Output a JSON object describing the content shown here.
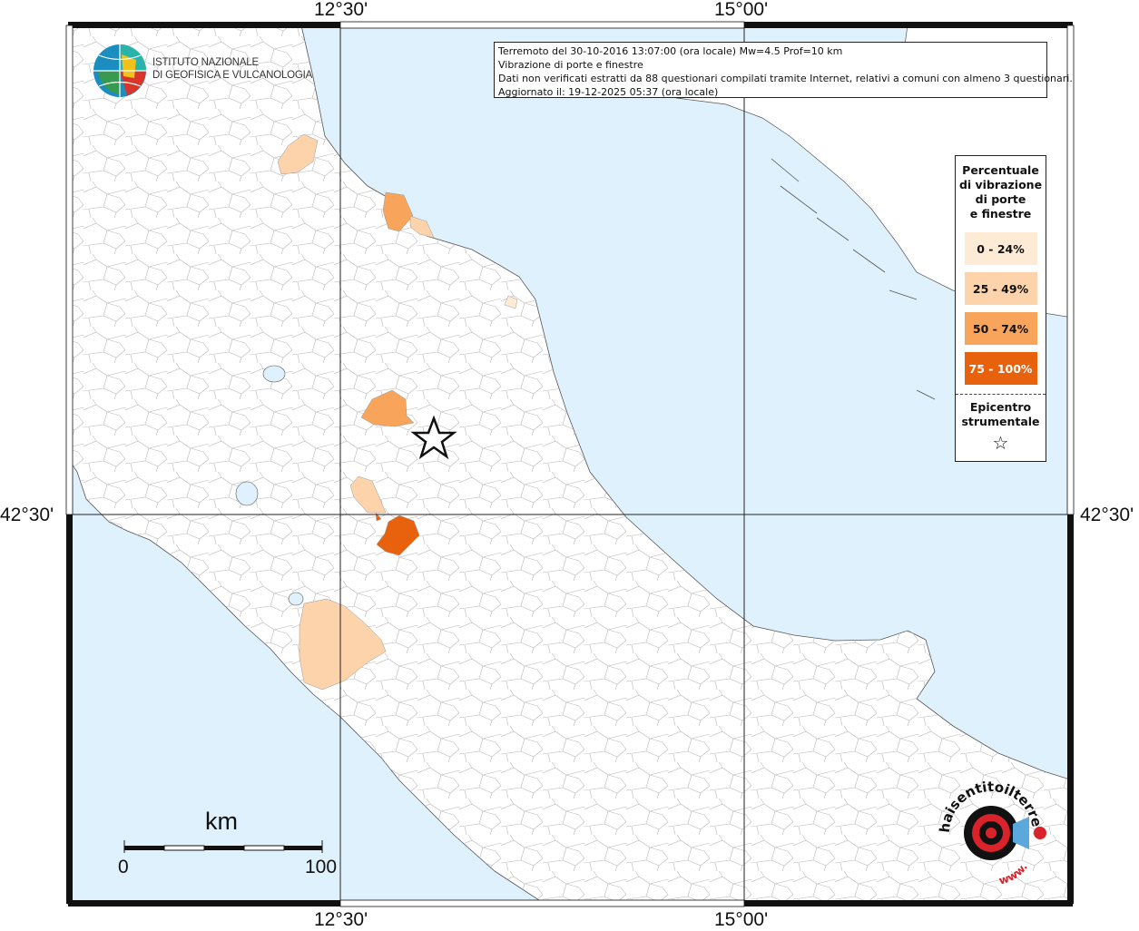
{
  "info": {
    "line1": "Terremoto del 30-10-2016 13:07:00 (ora locale) Mw=4.5 Prof=10 km",
    "line2": "Vibrazione di porte e finestre",
    "line3": "Dati non verificati estratti da 88 questionari compilati tramite Internet, relativi a comuni con almeno 3 questionari.",
    "line4": "Aggiornato il: 19-12-2025 05:37 (ora locale)"
  },
  "axes": {
    "top_left": "12°30'",
    "top_right": "15°00'",
    "bottom_left": "12°30'",
    "bottom_right": "15°00'",
    "left_lat": "42°30'",
    "right_lat": "42°30'"
  },
  "legend": {
    "title": "Percentuale\ndi vibrazione\ndi porte\ne finestre",
    "items": [
      {
        "label": "0 - 24%",
        "color": "#fdebd6",
        "text_color": "#111111"
      },
      {
        "label": "25 - 49%",
        "color": "#fdd3ac",
        "text_color": "#111111"
      },
      {
        "label": "50 - 74%",
        "color": "#f9a45b",
        "text_color": "#111111"
      },
      {
        "label": "75 - 100%",
        "color": "#e8620e",
        "text_color": "#ffffff"
      }
    ],
    "epicenter_title": "Epicentro\nstrumentale",
    "epicenter_symbol": "☆"
  },
  "ingv": {
    "line1": "ISTITUTO NAZIONALE",
    "line2": "DI GEOFISICA E VULCANOLOGIA"
  },
  "scale": {
    "title": "km",
    "min": "0",
    "max": "100"
  },
  "hsit_logo": {
    "text": "haisentitoilterremoto.it",
    "www": "www."
  },
  "colors": {
    "sea": "#dff1fc",
    "land": "#ffffff",
    "c0_24": "#fdebd6",
    "c25_49": "#fdd3ac",
    "c50_74": "#f9a45b",
    "c75_100": "#e8620e"
  }
}
